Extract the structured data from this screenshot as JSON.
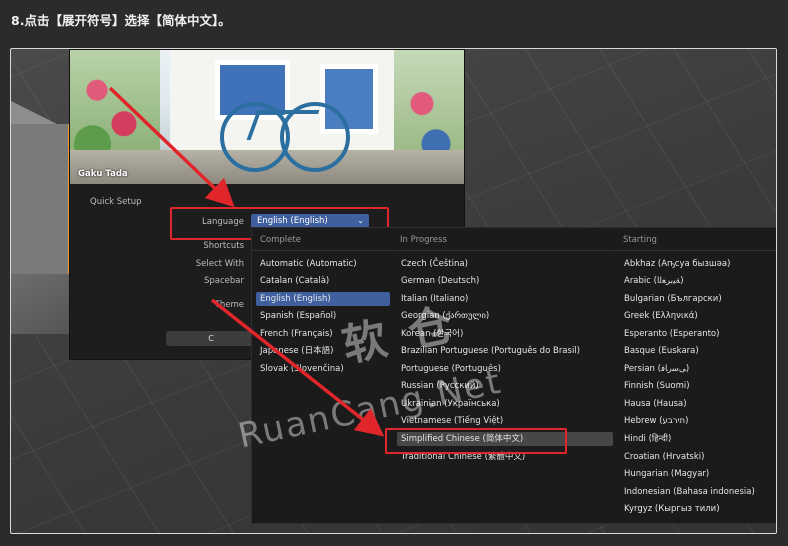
{
  "caption": "8.点击【展开符号】选择【简体中文】。",
  "splash": {
    "credit": "Gaku Tada",
    "quick_setup": "Quick Setup",
    "language_label": "Language",
    "language_value": "English (English)",
    "shortcuts_label": "Shortcuts",
    "select_with_label": "Select With",
    "spacebar_label": "Spacebar",
    "theme_label": "Theme",
    "button_char": "C"
  },
  "popup": {
    "complete_header": "Complete",
    "in_progress_header": "In Progress",
    "starting_header": "Starting",
    "complete": [
      "Automatic (Automatic)",
      "Catalan (Català)",
      "English (English)",
      "Spanish (Español)",
      "French (Français)",
      "Japanese (日本語)",
      "Slovak (Slovenčina)"
    ],
    "in_progress": [
      "Czech (Čeština)",
      "German (Deutsch)",
      "Italian (Italiano)",
      "Georgian (ქართული)",
      "Korean (한국어)",
      "Brazilian Portuguese (Português do Brasil)",
      "Portuguese (Português)",
      "Russian (Русский)",
      "Ukrainian (Українська)",
      "Vietnamese (Tiếng Việt)",
      "Simplified Chinese (简体中文)",
      "Traditional Chinese (繁體中文)"
    ],
    "starting": [
      "Abkhaz (Аҧсуа бызшәа)",
      "Arabic (ﺔﻴﺑﺮﻌﻟﺍ)",
      "Bulgarian (Български)",
      "Greek (Ελληνικά)",
      "Esperanto (Esperanto)",
      "Basque (Euskara)",
      "Persian (ﯽﺳﺭﺎﻓ)",
      "Finnish (Suomi)",
      "Hausa (Hausa)",
      "Hebrew (תירבע)",
      "Hindi (हिन्दी)",
      "Croatian (Hrvatski)",
      "Hungarian (Magyar)",
      "Indonesian (Bahasa indonesia)",
      "Kyrgyz (Кыргыз тили)"
    ]
  },
  "watermark": {
    "cn": "软 仓",
    "en": "RuanCang.Net"
  },
  "colors": {
    "highlight_red": "#e0262a",
    "selection_blue": "#3f5f9e"
  }
}
